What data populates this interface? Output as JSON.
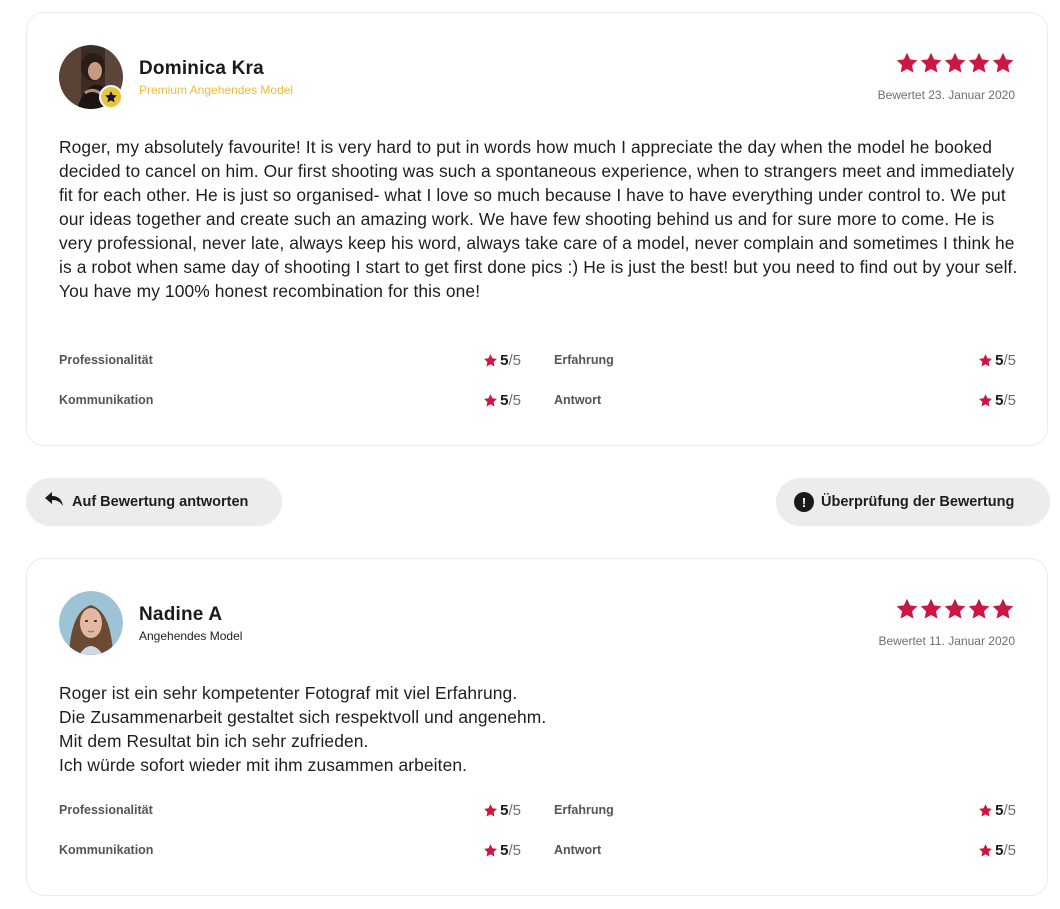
{
  "colors": {
    "star": "#cc1744",
    "premium": "#e9bd39",
    "pill_bg": "#ececec"
  },
  "reviews": [
    {
      "name": "Dominica Kra",
      "role": "Premium Angehendes Model",
      "premium": true,
      "avatar_icon": "avatar-photo",
      "rating": 5,
      "date": "Bewertet 23. Januar 2020",
      "text": [
        "Roger, my absolutely favourite! It is very hard to put in words how much I appreciate the day when the model he booked decided to cancel on him. Our first shooting was such a spontaneous experience, when to strangers meet and immediately fit for each other. He is just so organised- what I love so much because I have to have everything under control to. We put our ideas together and create such an amazing work. We have few shooting behind us and for sure more to come. He is very professional, never late, always keep his word, always take care of a model, never complain and sometimes I think he is a robot when same day of shooting I start to get first done pics :) He is just the best! but you need to find out by your self. You have my 100% honest recombination for this one!"
      ],
      "criteria": [
        {
          "label": "Professionalität",
          "score": "5",
          "max": "/5"
        },
        {
          "label": "Erfahrung",
          "score": "5",
          "max": "/5"
        },
        {
          "label": "Kommunikation",
          "score": "5",
          "max": "/5"
        },
        {
          "label": "Antwort",
          "score": "5",
          "max": "/5"
        }
      ]
    },
    {
      "name": "Nadine A",
      "role": "Angehendes Model",
      "premium": false,
      "avatar_icon": "avatar-photo",
      "rating": 5,
      "date": "Bewertet 11. Januar 2020",
      "text": [
        "Roger ist ein sehr kompetenter Fotograf mit viel Erfahrung.",
        "Die Zusammenarbeit gestaltet sich respektvoll und angenehm.",
        "Mit dem Resultat bin ich sehr zufrieden.",
        "Ich würde sofort wieder mit ihm zusammen arbeiten."
      ],
      "criteria": [
        {
          "label": "Professionalität",
          "score": "5",
          "max": "/5"
        },
        {
          "label": "Erfahrung",
          "score": "5",
          "max": "/5"
        },
        {
          "label": "Kommunikation",
          "score": "5",
          "max": "/5"
        },
        {
          "label": "Antwort",
          "score": "5",
          "max": "/5"
        }
      ]
    }
  ],
  "actions": {
    "reply_label": "Auf Bewertung antworten",
    "reply_icon": "reply-arrow-icon",
    "review_check_label": "Überprüfung der Bewertung",
    "review_check_icon": "exclamation-icon"
  }
}
